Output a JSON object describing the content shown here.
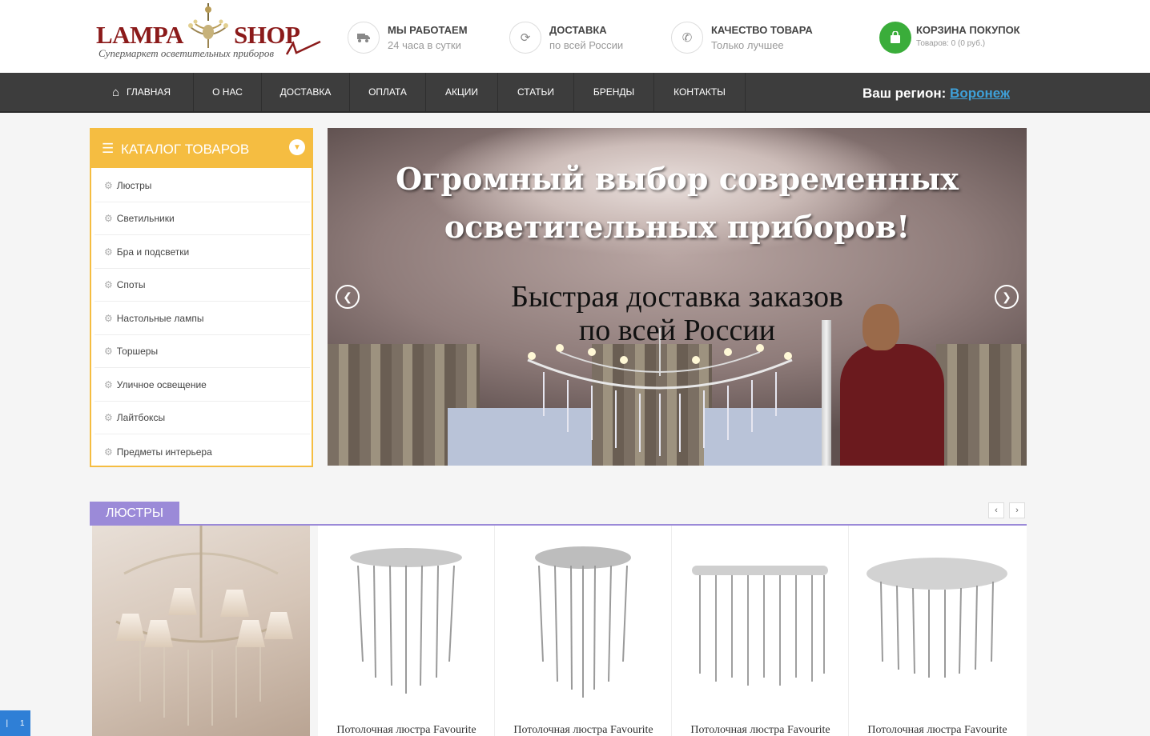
{
  "header": {
    "logo": {
      "left": "LAMPA",
      "right": "SHOP",
      "tagline": "Супермаркет осветительных приборов"
    },
    "features": [
      {
        "icon": "truck-icon",
        "title": "МЫ РАБОТАЕМ",
        "subtitle": "24 часа в сутки"
      },
      {
        "icon": "refresh-icon",
        "title": "ДОСТАВКА",
        "subtitle": "по всей России"
      },
      {
        "icon": "phone-icon",
        "title": "КАЧЕСТВО ТОВАРА",
        "subtitle": "Только лучшее"
      }
    ],
    "cart": {
      "icon": "shopping-bag-icon",
      "title": "КОРЗИНА ПОКУПОК",
      "subtitle": "Товаров: 0 (0 руб.)",
      "color": "#3aad3a"
    }
  },
  "nav": {
    "items": [
      "ГЛАВНАЯ",
      "О НАС",
      "ДОСТАВКА",
      "ОПЛАТА",
      "АКЦИИ",
      "СТАТЬИ",
      "БРЕНДЫ",
      "КОНТАКТЫ"
    ],
    "region_label": "Ваш регион:",
    "region_city": "Воронеж",
    "background": "#3d3d3d"
  },
  "catalog": {
    "title": "КАТАЛОГ ТОВАРОВ",
    "accent": "#f5bd41",
    "items": [
      "Люстры",
      "Светильники",
      "Бра и подсветки",
      "Споты",
      "Настольные лампы",
      "Торшеры",
      "Уличное освещение",
      "Лайтбоксы",
      "Предметы интерьера"
    ]
  },
  "slider": {
    "title_line1": "Огромный выбор современных",
    "title_line2": "осветительных приборов!",
    "subtitle_line1": "Быстрая доставка заказов",
    "subtitle_line2": "по всей России"
  },
  "section": {
    "title": "ЛЮСТРЫ",
    "accent": "#9b8ad8",
    "products": [
      {
        "name": "Потолочная люстра Favourite"
      },
      {
        "name": "Потолочная люстра Favourite"
      },
      {
        "name": "Потолочная люстра Favourite"
      },
      {
        "name": "Потолочная люстра Favourite"
      }
    ]
  },
  "widget": {
    "a": "|",
    "b": "1"
  }
}
